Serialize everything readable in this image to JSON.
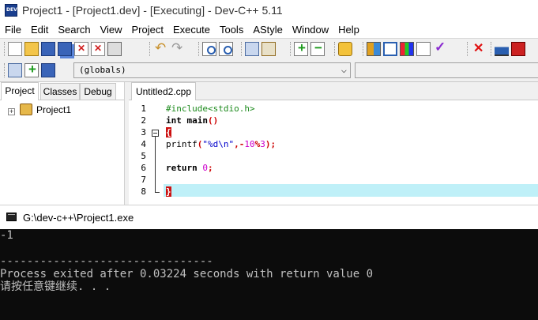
{
  "window": {
    "title": "Project1 - [Project1.dev] - [Executing] - Dev-C++ 5.11"
  },
  "menu": [
    "File",
    "Edit",
    "Search",
    "View",
    "Project",
    "Execute",
    "Tools",
    "AStyle",
    "Window",
    "Help"
  ],
  "scope": {
    "selected": "(globals)"
  },
  "left_panel": {
    "tabs": [
      "Project",
      "Classes",
      "Debug"
    ],
    "tree_item": "Project1"
  },
  "editor": {
    "tab_label": "Untitled2.cpp",
    "line_numbers": [
      "1",
      "2",
      "3",
      "4",
      "5",
      "6",
      "7",
      "8"
    ],
    "code": {
      "l1": "#include<stdio.h>",
      "l2_kw": "int",
      "l2_name": " main",
      "l2_paren": "()",
      "l3": "{",
      "l4_fn": "printf",
      "l4_p1": "(",
      "l4_str": "\"%d\\n\"",
      "l4_c": ",-",
      "l4_n1": "10",
      "l4_op": "%",
      "l4_n2": "3",
      "l4_end": ");",
      "l6_kw": "return",
      "l6_num": " 0",
      "l6_end": ";",
      "l8": "}"
    }
  },
  "console": {
    "title": "G:\\dev-c++\\Project1.exe",
    "lines": [
      "-1",
      "",
      "--------------------------------",
      "Process exited after 0.03224 seconds with return value 0",
      "请按任意键继续. . ."
    ]
  },
  "colors": {
    "current_line_bg": "#bff0f8",
    "console_bg": "#0c0c0c",
    "preprocessor": "#1c8a1c",
    "string": "#0000cc",
    "number": "#cc00cc",
    "symbol": "#cc0000"
  }
}
